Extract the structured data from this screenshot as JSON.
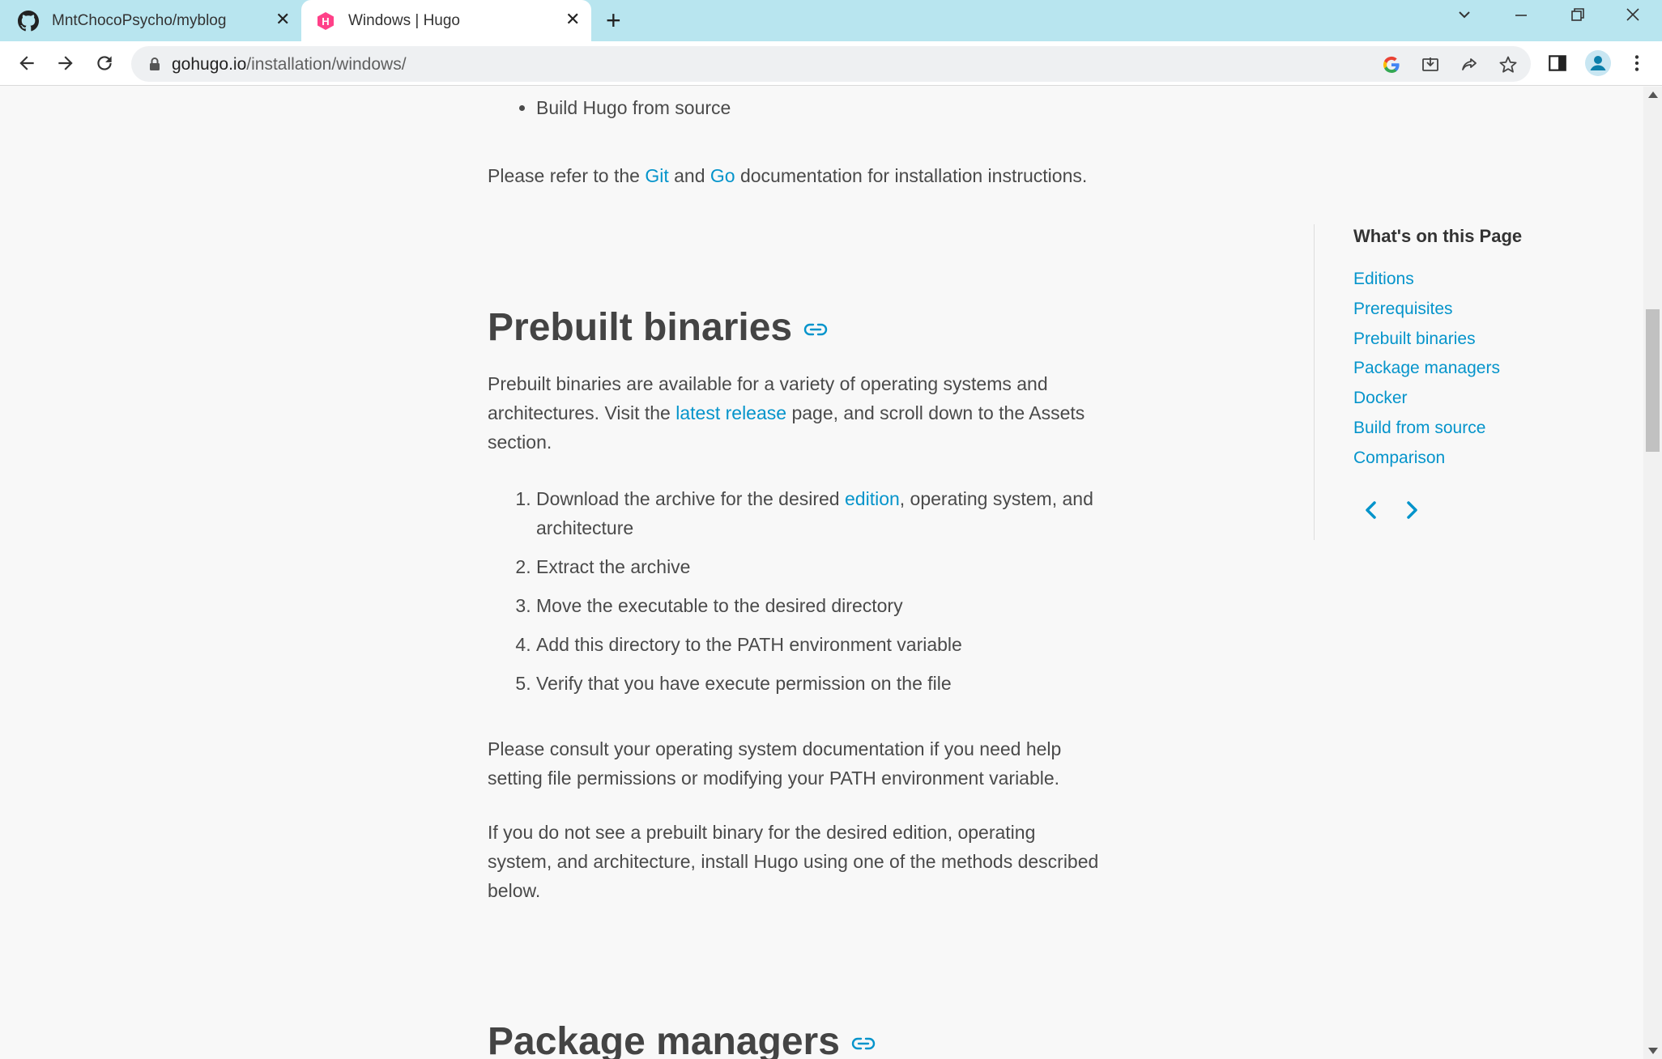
{
  "browser": {
    "tabs": [
      {
        "title": "MntChocoPsycho/myblog",
        "icon": "github-icon",
        "active": false
      },
      {
        "title": "Windows | Hugo",
        "icon": "hugo-icon",
        "active": true
      }
    ],
    "url_domain": "gohugo.io",
    "url_path": "/installation/windows/",
    "accent": "#0594cb",
    "tab_strip_color": "#b8e5ef"
  },
  "content": {
    "bullet_item": "Build Hugo from source",
    "refer": {
      "before": "Please refer to the ",
      "link1": "Git",
      "middle": " and ",
      "link2": "Go",
      "after": " documentation for installation instructions."
    },
    "heading_prebuilt": "Prebuilt binaries",
    "prebuilt_para": {
      "line1": "Prebuilt binaries are available for a variety of operating systems and",
      "line2_before": "architectures. Visit the ",
      "link": "latest release",
      "line2_after": " page, and scroll down to the Assets",
      "line3": "section."
    },
    "steps": {
      "s1_before": "Download the archive for the desired ",
      "s1_link": "edition",
      "s1_after": ", operating system, and",
      "s1_line2": "architecture",
      "s2": "Extract the archive",
      "s3": "Move the executable to the desired directory",
      "s4": "Add this directory to the PATH environment variable",
      "s5": "Verify that you have execute permission on the file"
    },
    "consult_para": {
      "line1": "Please consult your operating system documentation if you need help",
      "line2": "setting file permissions or modifying your PATH environment variable."
    },
    "fallback_para": {
      "line1": "If you do not see a prebuilt binary for the desired edition, operating",
      "line2": "system, and architecture, install Hugo using one of the methods described",
      "line3": "below."
    },
    "heading_package": "Package managers"
  },
  "toc": {
    "title": "What's on this Page",
    "items": [
      "Editions",
      "Prerequisites",
      "Prebuilt binaries",
      "Package managers",
      "Docker",
      "Build from source",
      "Comparison"
    ]
  }
}
